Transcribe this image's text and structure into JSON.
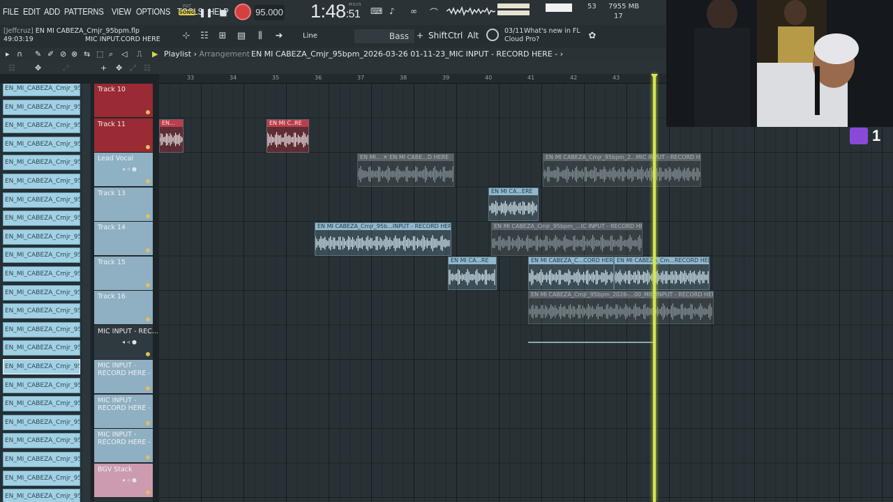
{
  "menu": [
    "FILE",
    "EDIT",
    "ADD",
    "PATTERNS",
    "VIEW",
    "OPTIONS",
    "TOOLS",
    "HELP"
  ],
  "transport": {
    "pat_label": "PAT",
    "song_label": "SONG",
    "tempo": "95.000",
    "time_main": "1:48",
    "time_sub": ":51",
    "time_unit": "M:S:CS"
  },
  "system": {
    "cpu": "53",
    "memory": "7955 MB",
    "voices": "17"
  },
  "file": {
    "user": "[Jeffcruz]",
    "name": "EN MI CABEZA_Cmjr_95bpm.flp",
    "elapsed": "49:03:19",
    "hint": "MIC INPUT.CORD HERE"
  },
  "toolbar": {
    "snap": "Line",
    "preset": "Bass",
    "shift": "Shift",
    "ctrl": "Ctrl",
    "alt": "Alt",
    "news_date": "03/11",
    "news_text_1": "What's new in FL",
    "news_text_2": "Cloud Pro?"
  },
  "playlist": {
    "title": "Playlist",
    "subtitle": "Arrangement",
    "path": "EN MI CABEZA_Cmjr_95bpm_2026-03-26 01-11-23_MIC INPUT - RECORD HERE -",
    "bars": [
      "33",
      "34",
      "35",
      "36",
      "37",
      "38",
      "39",
      "40",
      "41",
      "42",
      "43"
    ]
  },
  "picker": {
    "label": "EN_MI_CABEZA_Cmjr_95bp...",
    "count": 23,
    "selected_index": 15
  },
  "tracks": [
    {
      "name": "Track 10"
    },
    {
      "name": "Track 11"
    },
    {
      "name": "Lead Vocal"
    },
    {
      "name": "Track 13"
    },
    {
      "name": "Track 14"
    },
    {
      "name": "Track 15"
    },
    {
      "name": "Track 16"
    },
    {
      "name": "MIC INPUT - REC..."
    },
    {
      "name": "MIC INPUT -\nRECORD HERE -"
    },
    {
      "name": "MIC INPUT -\nRECORD HERE -"
    },
    {
      "name": "MIC INPUT -\nRECORD HERE -"
    },
    {
      "name": "BGV Stack"
    }
  ],
  "clips": [
    {
      "label": "EN...",
      "muted": false
    },
    {
      "label": "EN MI C..RE",
      "muted": false
    },
    {
      "label": "EN MI... ✕ EN MI CABE...D HERE",
      "muted": true
    },
    {
      "label": "EN MI CABEZA_Cmjr_95bpm_2...MIC INPUT - RECORD HERE",
      "muted": true
    },
    {
      "label": "EN MI CA...ERE",
      "muted": false
    },
    {
      "label": "EN MI CABEZA_Cmjr_95b...INPUT - RECORD HERE",
      "muted": false
    },
    {
      "label": "EN MI CABEZA_Cmjr_95bpm_...IC INPUT - RECORD HERE",
      "muted": true
    },
    {
      "label": "EN MI CA...RE",
      "muted": false
    },
    {
      "label": "EN MI CABEZA_C...CORD HERE",
      "muted": false
    },
    {
      "label": "EN MI CABEZA_Cm...RECORD HERE",
      "muted": false
    },
    {
      "label": "EN MI CABEZA_Cmjr_95bpm_2026-...00_MIC INPUT - RECORD HERE",
      "muted": true
    }
  ],
  "overlay": {
    "twitch_count": "1"
  },
  "colors": {
    "playhead": "#d4e64b",
    "record": "#d44040",
    "clip_active": "#91b8cd",
    "track_red": "#9a2a33",
    "track_pink": "#cc9bb0"
  }
}
